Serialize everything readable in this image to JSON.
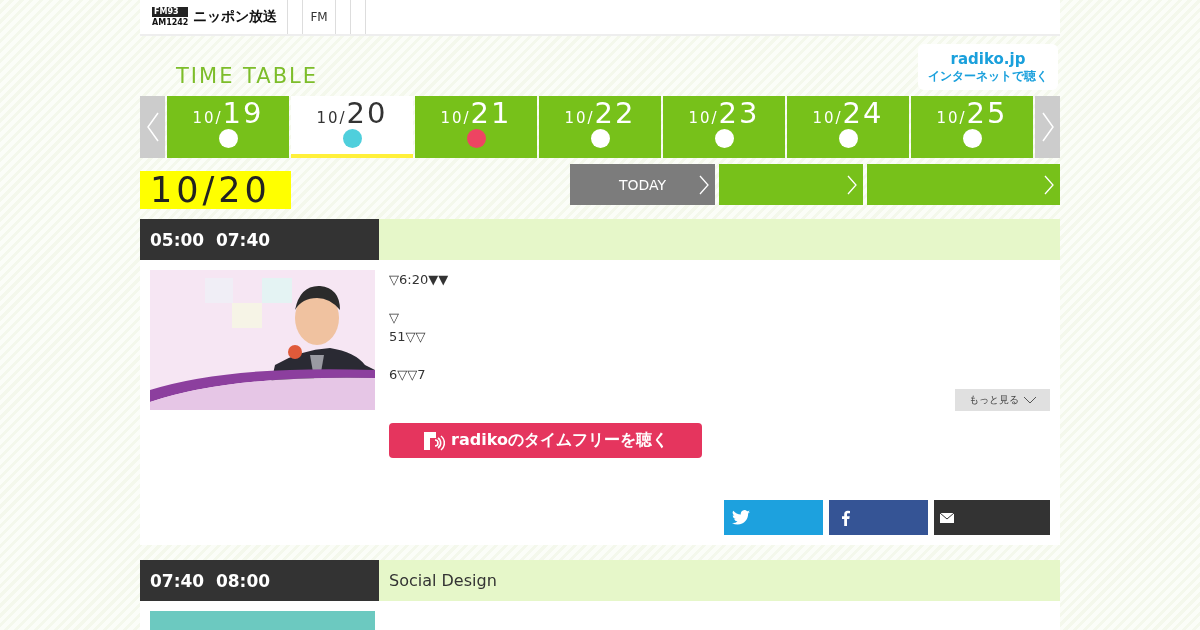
{
  "header": {
    "logo_small_top": "FM93",
    "logo_small_bottom": "AM1242",
    "logo": "ニッポン放送",
    "nav": [
      {
        "kind": "tab"
      },
      {
        "kind": "tab",
        "label": "FM"
      },
      {
        "kind": "tab"
      },
      {
        "kind": "tab"
      }
    ]
  },
  "title": "TIME TABLE",
  "radiko_badge": {
    "name": "radiko.jp",
    "tagline": "インターネットで聴く"
  },
  "dates": [
    {
      "month": "10/",
      "day": "19",
      "selected": false,
      "color": "#ffffff"
    },
    {
      "month": "10/",
      "day": "20",
      "selected": true,
      "color": "#4fcfdc"
    },
    {
      "month": "10/",
      "day": "21",
      "selected": false,
      "color": "#ee4462"
    },
    {
      "month": "10/",
      "day": "22",
      "selected": false,
      "color": "#ffffff"
    },
    {
      "month": "10/",
      "day": "23",
      "selected": false,
      "color": "#ffffff"
    },
    {
      "month": "10/",
      "day": "24",
      "selected": false,
      "color": "#ffffff"
    },
    {
      "month": "10/",
      "day": "25",
      "selected": false,
      "color": "#ffffff"
    }
  ],
  "current_date": "10/20",
  "day_buttons": [
    {
      "label": "TODAY",
      "kind": "today"
    },
    {
      "kind": "next"
    },
    {
      "kind": "next"
    }
  ],
  "programs": [
    {
      "start": "05:00",
      "end": "07:40",
      "description": [
        [
          "▽6:20▼▼"
        ],
        [
          "▽",
          "51▽▽"
        ],
        [
          "6▽▽7"
        ]
      ],
      "more": "もっと見る",
      "radiko_button": "radikoのタイムフリーを聴く",
      "share": [
        {
          "kind": "twitter"
        },
        {
          "kind": "facebook"
        },
        {
          "kind": "mail"
        }
      ]
    },
    {
      "start": "07:40",
      "end": "08:00",
      "title": "Social Design"
    }
  ]
}
